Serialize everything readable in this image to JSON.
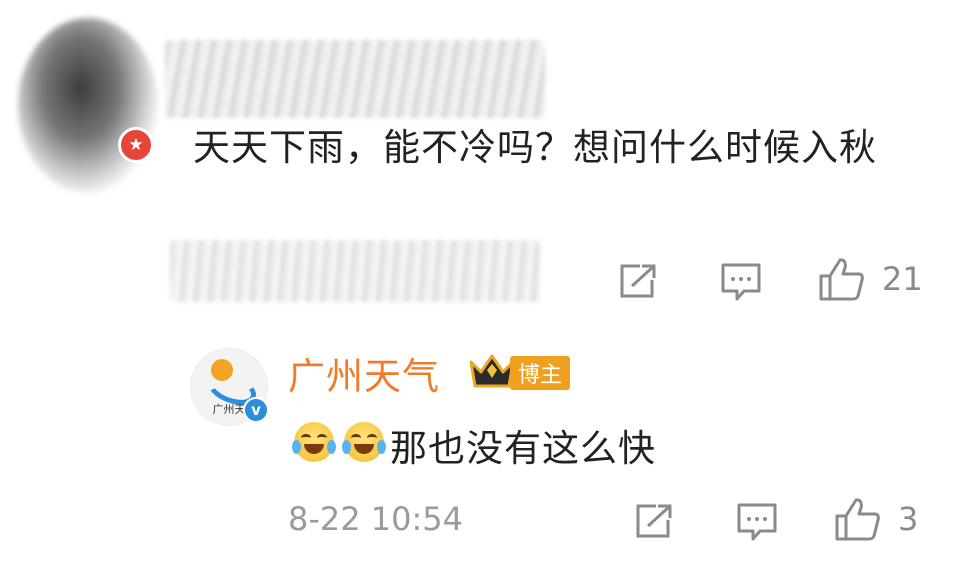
{
  "comment": {
    "text": "天天下雨，能不冷吗？想问什么时候入秋",
    "badge_icon": "star-badge-icon",
    "actions": {
      "share_icon": "share-icon",
      "comment_icon": "comment-icon",
      "like_icon": "thumbs-up-icon",
      "like_count": "21"
    }
  },
  "reply": {
    "author": "广州天气",
    "avatar_text": "广州天",
    "badge_label": "博主",
    "text": "那也没有这么快",
    "emojis": [
      "laugh-cry-emoji",
      "laugh-cry-emoji"
    ],
    "timestamp": "8-22 10:54",
    "actions": {
      "share_icon": "share-icon",
      "comment_icon": "comment-icon",
      "like_icon": "thumbs-up-icon",
      "like_count": "3"
    }
  },
  "colors": {
    "author_name": "#f07c2b",
    "blogger_badge": "#f0a020",
    "verified": "#2a8ed8",
    "star_badge": "#e6463a",
    "action_gray": "#8a8a8a"
  }
}
